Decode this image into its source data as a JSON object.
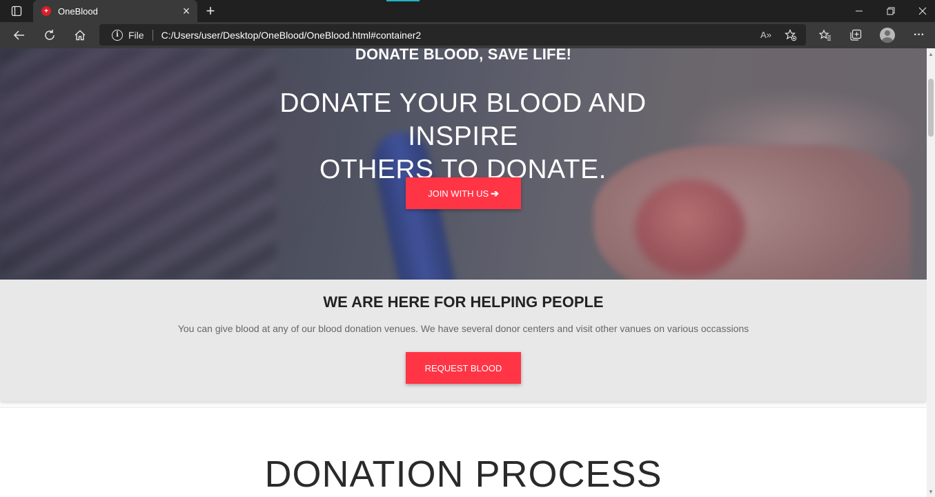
{
  "browser": {
    "tab_title": "OneBlood",
    "favicon_glyph": "+",
    "new_tab_glyph": "+",
    "close_glyph": "×",
    "minimize_glyph": "—",
    "restore_glyph": "❐",
    "window_close_glyph": "✕",
    "info_glyph": "i",
    "scheme": "File",
    "url": "C:/Users/user/Desktop/OneBlood/OneBlood.html#container2",
    "read_aloud_glyph": "A»",
    "more_glyph": "···",
    "icons": [
      "tab-actions-icon",
      "back-arrow-icon",
      "refresh-icon",
      "home-icon",
      "read-aloud-icon",
      "add-favorite-icon",
      "favorites-icon",
      "collections-icon",
      "profile-icon",
      "more-icon"
    ],
    "accent_color": "#1fb5c4"
  },
  "hero": {
    "tagline": "DONATE BLOOD, SAVE LIFE!",
    "headline_line1": "DONATE YOUR BLOOD AND INSPIRE",
    "headline_line2": "OTHERS TO DONATE.",
    "join_label": "JOIN WITH US",
    "join_arrow": "➔"
  },
  "help": {
    "title": "WE ARE HERE FOR HELPING PEOPLE",
    "text": "You can give blood at any of our blood donation venues. We have several donor centers and visit other vanues on various occassions",
    "request_label": "REQUEST BLOOD"
  },
  "process": {
    "title": "DONATION PROCESS"
  },
  "colors": {
    "brand_red": "#ff3546",
    "chrome_dark": "#202020",
    "chrome_mid": "#3a3a3a"
  }
}
